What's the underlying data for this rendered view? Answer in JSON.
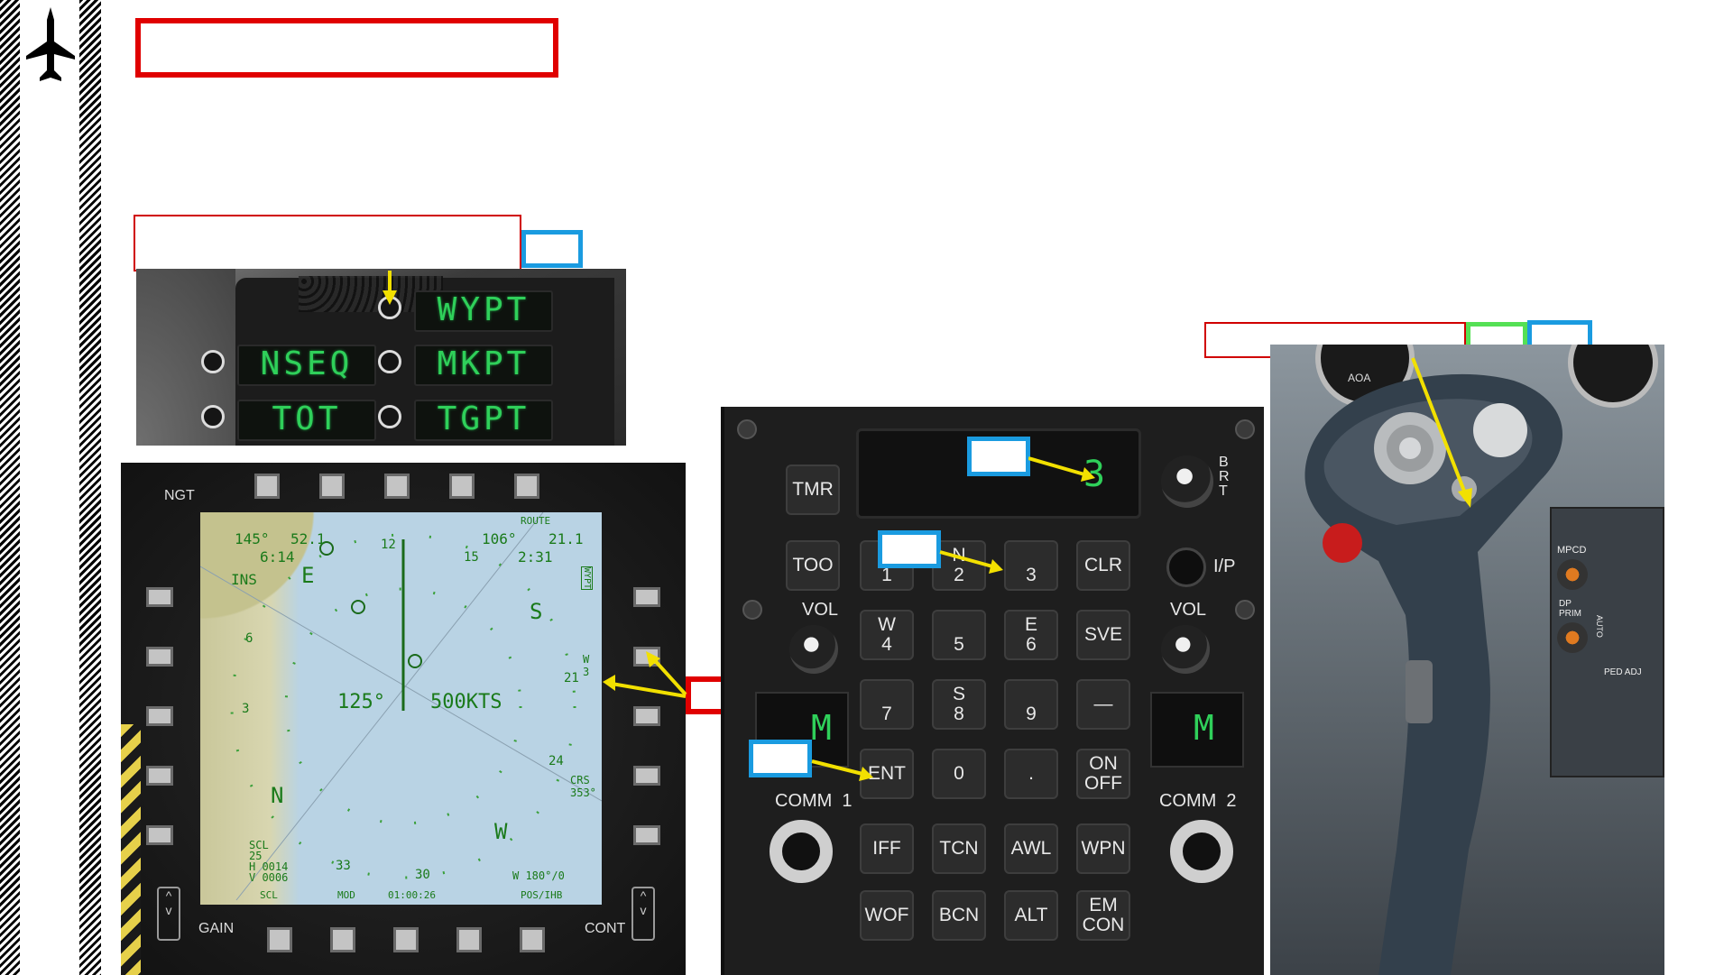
{
  "colors": {
    "callout_red": "#e00000",
    "callout_blue": "#1a9be0",
    "callout_green": "#54e054",
    "arrow_yellow": "#f2e000",
    "display_green": "#2fd05a"
  },
  "sidebar": {
    "icon": "jet-aircraft-icon"
  },
  "waypoint_panel": {
    "labels": [
      "WYPT",
      "NSEQ",
      "MKPT",
      "TOT",
      "TGPT"
    ]
  },
  "mfd": {
    "bezel_labels": {
      "ngt": "NGT",
      "gain": "GAIN",
      "cont": "CONT"
    },
    "map_text": {
      "brg_tl": "145°",
      "dist_tl": "52.1",
      "time_tl": "6:14",
      "ins": "INS",
      "route": "ROUTE",
      "brg_tr": "106°",
      "dist_tr": "21.1",
      "time_tr": "2:31",
      "wypt_box": "WYPT",
      "heading": "125°",
      "speed": "500KTS",
      "compass_e": "E",
      "compass_s": "S",
      "compass_n": "N",
      "compass_w": "W",
      "crs": "CRS",
      "crs_val": "353°",
      "w3": "W 3",
      "scl": "SCL",
      "scl_val": "25",
      "h_val": "H 0014",
      "v_val": "V 0006",
      "bottom_left": "SCL",
      "bottom_mid_1": "MOD",
      "clock": "01:00:26",
      "wind": "W 180°/0",
      "pos": "POS/IHB",
      "tick_33": "33",
      "tick_30": "30",
      "tick_12": "12",
      "tick_15": "15",
      "tick_21": "21",
      "tick_24": "24",
      "tick_6": "6",
      "tick_3": "3"
    }
  },
  "ufc": {
    "scratchpad_value": "3",
    "brt": "B\nR\nT",
    "ip": "I/P",
    "vol_left": "VOL",
    "vol_right": "VOL",
    "comm1": "COMM  1",
    "comm2": "COMM  2",
    "comm1_display": "M",
    "comm2_display": "M",
    "keys": {
      "tmr": "TMR",
      "too": "TOO",
      "k1": "\n1",
      "k2": "N\n2",
      "k3": "\n3",
      "clr": "CLR",
      "k4": "W\n4",
      "k5": "\n5",
      "k6": "E\n6",
      "sve": "SVE",
      "k7": "\n7",
      "k8": "S\n8",
      "k9": "\n9",
      "dash": "—",
      "ent": "ENT",
      "k0": "0",
      "dot": ".",
      "onoff": "ON\nOFF",
      "iff": "IFF",
      "tcn": "TCN",
      "awl": "AWL",
      "wpn": "WPN",
      "wof": "WOF",
      "bcn": "BCN",
      "alt": "ALT",
      "emcon": "EM\nCON"
    }
  },
  "stick_photo": {
    "placards": {
      "aoa": "AOA",
      "mpcd": "MPCD",
      "dp_prim": "DP\nPRIM",
      "auto": "AUTO",
      "ped_adj": "PED ADJ"
    }
  }
}
